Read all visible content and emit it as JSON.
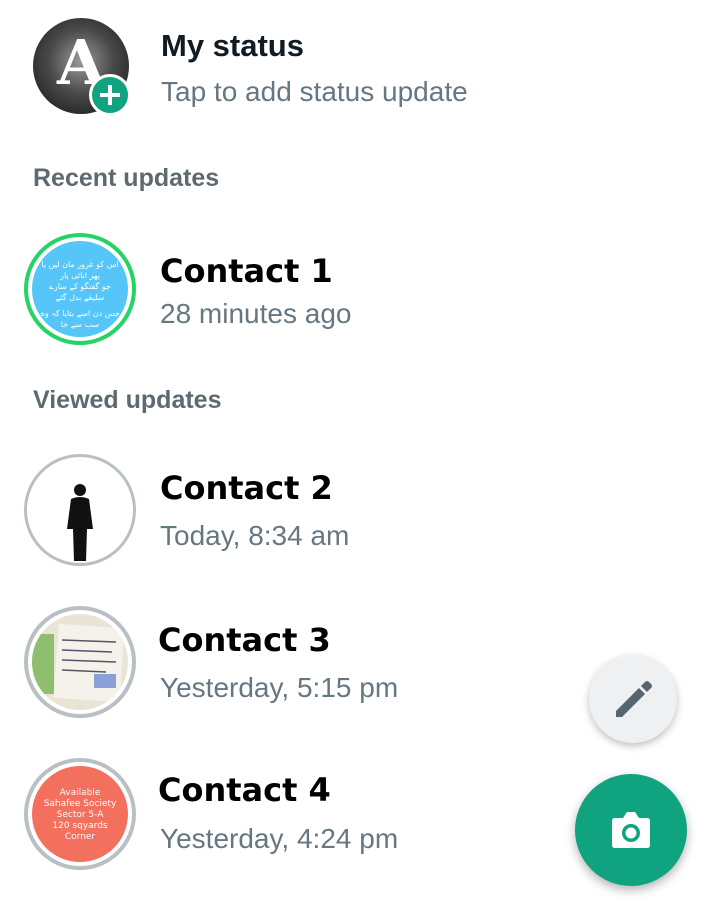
{
  "my_status": {
    "title": "My status",
    "subtitle": "Tap to add status update",
    "avatar_letter": "A"
  },
  "sections": {
    "recent": "Recent updates",
    "viewed": "Viewed updates"
  },
  "contacts": [
    {
      "name": "Contact 1",
      "time": "28 minutes ago",
      "thumb_lines": [
        "اس کو غرور مان لیں یا",
        "پھر انائی پار",
        "جو گفتگو کے سارے",
        "سلیقے بدل گئے",
        "جس دن اسے بتایا کہ وہ",
        "سب سے خا"
      ]
    },
    {
      "name": "Contact 2",
      "time": "Today, 8:34 am"
    },
    {
      "name": "Contact 3",
      "time": "Yesterday, 5:15 pm"
    },
    {
      "name": "Contact 4",
      "time": "Yesterday, 4:24 pm",
      "thumb_lines": [
        "Available",
        "Sahafee Society",
        "Sector 5-A",
        "120 sqyards",
        "Corner"
      ]
    }
  ],
  "colors": {
    "accent": "#0fa37f",
    "unviewed_ring": "#25d366",
    "viewed_ring": "#b8c0c4",
    "secondary_text": "#667781"
  },
  "fabs": {
    "pencil_icon": "pencil-icon",
    "camera_icon": "camera-icon"
  }
}
